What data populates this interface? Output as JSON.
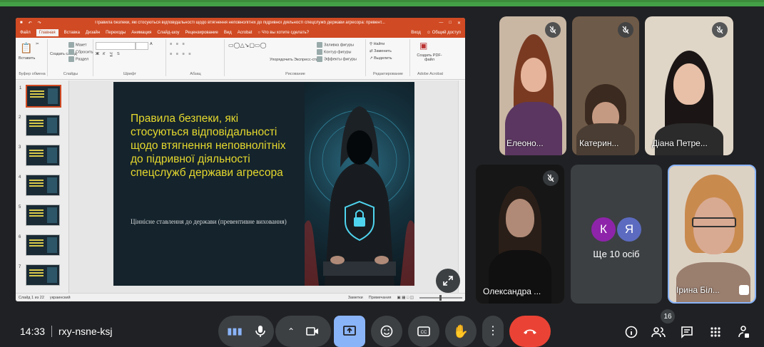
{
  "ppt": {
    "title_text": "Правила безпеки, які стосуються відповідальності щодо втягнення неповнолітніх до підривної діяльності спецслужб держави агресора: превент...",
    "tabs": [
      "Файл",
      "Главная",
      "Вставка",
      "Дизайн",
      "Переходы",
      "Анимация",
      "Слайд-шоу",
      "Рецензирование",
      "Вид",
      "Acrobat"
    ],
    "tell_me": "Что вы хотите сделать?",
    "sign_in": "Вход",
    "share": "Общий доступ",
    "ribbon": {
      "paste": "Вставить",
      "new_slide": "Создать слайд",
      "layout": "Макет",
      "reset": "Сбросить",
      "section": "Раздел",
      "arrange": "Упорядочить",
      "express_styles": "Экспресс-стили",
      "fill": "Заливка фигуры",
      "outline": "Контур фигуры",
      "effects": "Эффекты фигуры",
      "find": "Найти",
      "replace": "Заменить",
      "select": "Выделить",
      "create_pdf": "Создать PDF-файл",
      "groups": [
        "Буфер обмена",
        "Слайды",
        "Шрифт",
        "Абзац",
        "Рисование",
        "Редактирование",
        "Adobe Acrobat"
      ]
    },
    "thumb_numbers": [
      "1",
      "2",
      "3",
      "4",
      "5",
      "6",
      "7"
    ],
    "status_left": "Слайд 1 из 22",
    "status_lang": "украинский",
    "status_notes": "Заметки",
    "status_comments": "Примечания"
  },
  "slide": {
    "title": "Правила безпеки, які стосуються відповідальності щодо втягнення неповнолітніх до підривної діяльності спецслужб держави агресора",
    "subtitle": "Ціннісне ставлення до держави (превентивне виховання)"
  },
  "participants": [
    {
      "name": "Елеоно...",
      "muted": true
    },
    {
      "name": "Катерин...",
      "muted": true
    },
    {
      "name": "Діана Петре...",
      "muted": true
    },
    {
      "name": "Олександра ...",
      "muted": true
    },
    {
      "name": "Ірина Біл...",
      "muted": false
    }
  ],
  "more": {
    "avatars": [
      "К",
      "Я"
    ],
    "label": "Ще 10 осіб",
    "avatar_colors": [
      "#8e24aa",
      "#5c6bc0"
    ]
  },
  "meeting": {
    "time": "14:33",
    "code": "rxy-nsne-ksj",
    "participant_count": "16"
  },
  "colors": {
    "accent": "#8ab4f8",
    "end_call": "#ea4335",
    "slide_title": "#e6d92e",
    "ppt_red": "#d04a23"
  }
}
